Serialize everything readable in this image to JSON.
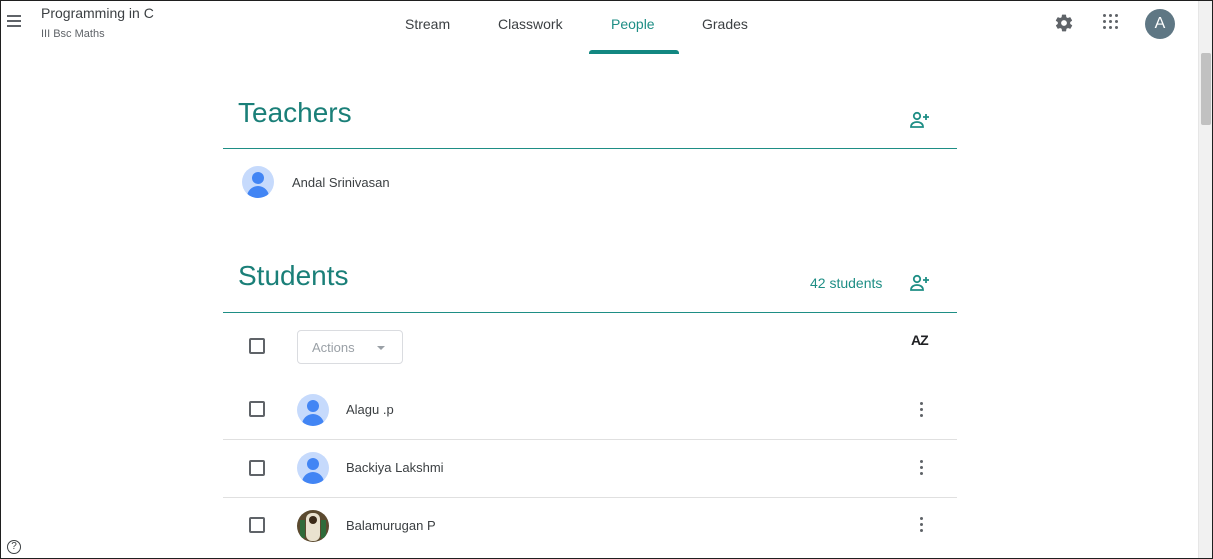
{
  "header": {
    "class_title": "Programming in C",
    "class_section": "III Bsc Maths",
    "tabs": [
      {
        "label": "Stream",
        "active": false
      },
      {
        "label": "Classwork",
        "active": false
      },
      {
        "label": "People",
        "active": true
      },
      {
        "label": "Grades",
        "active": false
      }
    ],
    "account_initial": "A",
    "icons": [
      "menu-icon",
      "gear-icon",
      "apps-grid-icon"
    ]
  },
  "teachers": {
    "title": "Teachers",
    "items": [
      {
        "name": "Andal Srinivasan"
      }
    ]
  },
  "students": {
    "title": "Students",
    "count_label": "42 students",
    "actions_label": "Actions",
    "sort_label": "AZ",
    "items": [
      {
        "name": "Alagu .p",
        "avatar": "default"
      },
      {
        "name": "Backiya Lakshmi",
        "avatar": "default"
      },
      {
        "name": "Balamurugan P",
        "avatar": "photo"
      }
    ]
  },
  "colors": {
    "accent": "#1e8e85",
    "avatar_bg": "#5f7784"
  },
  "help_label": "?"
}
